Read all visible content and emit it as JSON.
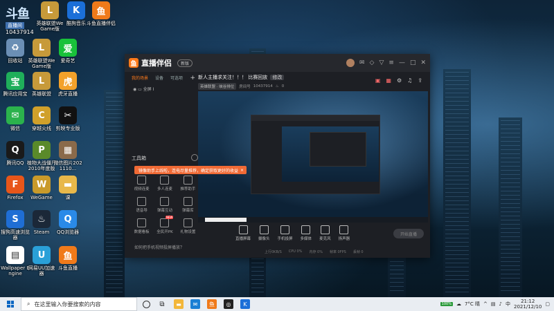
{
  "desktop": {
    "douyu_brand": {
      "mark": "斗鱼",
      "tag": "直播间",
      "room_id": "10437914"
    },
    "icons": [
      {
        "label": "英雄联盟WeGame版",
        "icon": "lol-icon",
        "color": "#c79a3a",
        "glyph": "L"
      },
      {
        "label": "酷狗音乐",
        "icon": "kugou-icon",
        "color": "#1b6fd8",
        "glyph": "K"
      },
      {
        "label": "斗鱼直播伴侣",
        "icon": "douyu-companion-icon",
        "color": "#f07a1a",
        "glyph": "鱼"
      },
      {
        "label": "回收站",
        "icon": "recycle-bin-icon",
        "color": "#6b8fb5",
        "glyph": "♻"
      },
      {
        "label": "英雄联盟WeGame版",
        "icon": "lol-icon",
        "color": "#c79a3a",
        "glyph": "L"
      },
      {
        "label": "爱奇艺",
        "icon": "iqiyi-icon",
        "color": "#19c23a",
        "glyph": "爱"
      },
      {
        "label": "腾讯应用宝",
        "icon": "yingyongbao-icon",
        "color": "#1fae5a",
        "glyph": "宝"
      },
      {
        "label": "英雄联盟",
        "icon": "lol-icon",
        "color": "#c79a3a",
        "glyph": "L"
      },
      {
        "label": "虎牙直播",
        "icon": "huya-icon",
        "color": "#f3a12a",
        "glyph": "虎"
      },
      {
        "label": "微信",
        "icon": "wechat-icon",
        "color": "#2bb24c",
        "glyph": "✉"
      },
      {
        "label": "穿越火线",
        "icon": "cf-icon",
        "color": "#d0a02a",
        "glyph": "C"
      },
      {
        "label": "剪映专业版",
        "icon": "jianying-icon",
        "color": "#111111",
        "glyph": "✂"
      },
      {
        "label": "腾讯QQ",
        "icon": "qq-icon",
        "color": "#1a1a1a",
        "glyph": "Q"
      },
      {
        "label": "植物大战僵尸2010年度版",
        "icon": "pvz-icon",
        "color": "#5a8a2a",
        "glyph": "P"
      },
      {
        "label": "微信图片2021110...",
        "icon": "image-icon",
        "color": "#8a6a4a",
        "glyph": "▦"
      },
      {
        "label": "Firefox",
        "icon": "firefox-icon",
        "color": "#e8561a",
        "glyph": "F"
      },
      {
        "label": "WeGame",
        "icon": "wegame-icon",
        "color": "#c99a2a",
        "glyph": "W"
      },
      {
        "label": "课",
        "icon": "folder-icon",
        "color": "#e8b84a",
        "glyph": "▬"
      },
      {
        "label": "搜狗高速浏览器",
        "icon": "sogou-browser-icon",
        "color": "#1f6ed4",
        "glyph": "S"
      },
      {
        "label": "Steam",
        "icon": "steam-icon",
        "color": "#1b2838",
        "glyph": "♨"
      },
      {
        "label": "QQ浏览器",
        "icon": "qq-browser-icon",
        "color": "#2a8ae8",
        "glyph": "Q"
      },
      {
        "label": "Wallpaper Engine",
        "icon": "wallpaper-engine-icon",
        "color": "#ffffff",
        "glyph": "▤"
      },
      {
        "label": "网易UU加速器",
        "icon": "uu-icon",
        "color": "#2aa0d8",
        "glyph": "U"
      },
      {
        "label": "斗鱼直播",
        "icon": "douyu-icon",
        "color": "#f07a1a",
        "glyph": "鱼"
      }
    ]
  },
  "window": {
    "app_name": "直播伴侣",
    "version_badge": "新版",
    "tabs": [
      "我的场景",
      "设备",
      "可选项"
    ],
    "plus": "+",
    "scene": "全屏 I",
    "tools_title": "工具箱",
    "toast": "镜像助手上线啦，连电尽量推荐，确定获取更好的收益",
    "toast_close": "×",
    "tools": [
      {
        "label": "视频连麦",
        "icon": "video-link-icon",
        "hot": ""
      },
      {
        "label": "多人连麦",
        "icon": "multi-link-icon",
        "hot": ""
      },
      {
        "label": "推荐助手",
        "icon": "recommend-icon",
        "hot": ""
      },
      {
        "label": "语音导",
        "icon": "voice-icon",
        "hot": ""
      },
      {
        "label": "弹幕互动",
        "icon": "danmaku-icon",
        "hot": ""
      },
      {
        "label": "弹幕库",
        "icon": "danmaku-lib-icon",
        "hot": ""
      },
      {
        "label": "数据看板",
        "icon": "dashboard-icon",
        "hot": ""
      },
      {
        "label": "全民开PK",
        "icon": "pk-icon",
        "hot": "NEW"
      },
      {
        "label": "礼物设置",
        "icon": "gift-icon",
        "hot": ""
      }
    ],
    "bottom_hint": "如何把手机视频投屏播放？",
    "live_title": "新人主播求关注！！！",
    "live_category": "比赛回放",
    "live_edit": "修改",
    "meta": {
      "area": "英雄联盟 · 峡谷排位",
      "room_label": "房间号",
      "room_id": "10437914",
      "fans": "0"
    },
    "controls": [
      {
        "label": "直播屏幕",
        "icon": "screen-icon"
      },
      {
        "label": "摄像头",
        "icon": "camera-icon"
      },
      {
        "label": "手机投屏",
        "icon": "phone-cast-icon"
      },
      {
        "label": "多媒体",
        "icon": "media-icon"
      },
      {
        "label": "麦克风",
        "icon": "mic-icon"
      },
      {
        "label": "扬声器",
        "icon": "speaker-icon"
      }
    ],
    "go_live": "开始直播",
    "status": [
      "上行0KB/S",
      "CPU 0%",
      "内存 0%",
      "帧率 0FPS",
      "丢帧 0"
    ]
  },
  "taskbar": {
    "search_placeholder": "在这里输入你要搜索的内容",
    "battery": "100%",
    "weather": "7°C 晴",
    "lang": "中",
    "time": "21:12",
    "date": "2021/12/10"
  }
}
